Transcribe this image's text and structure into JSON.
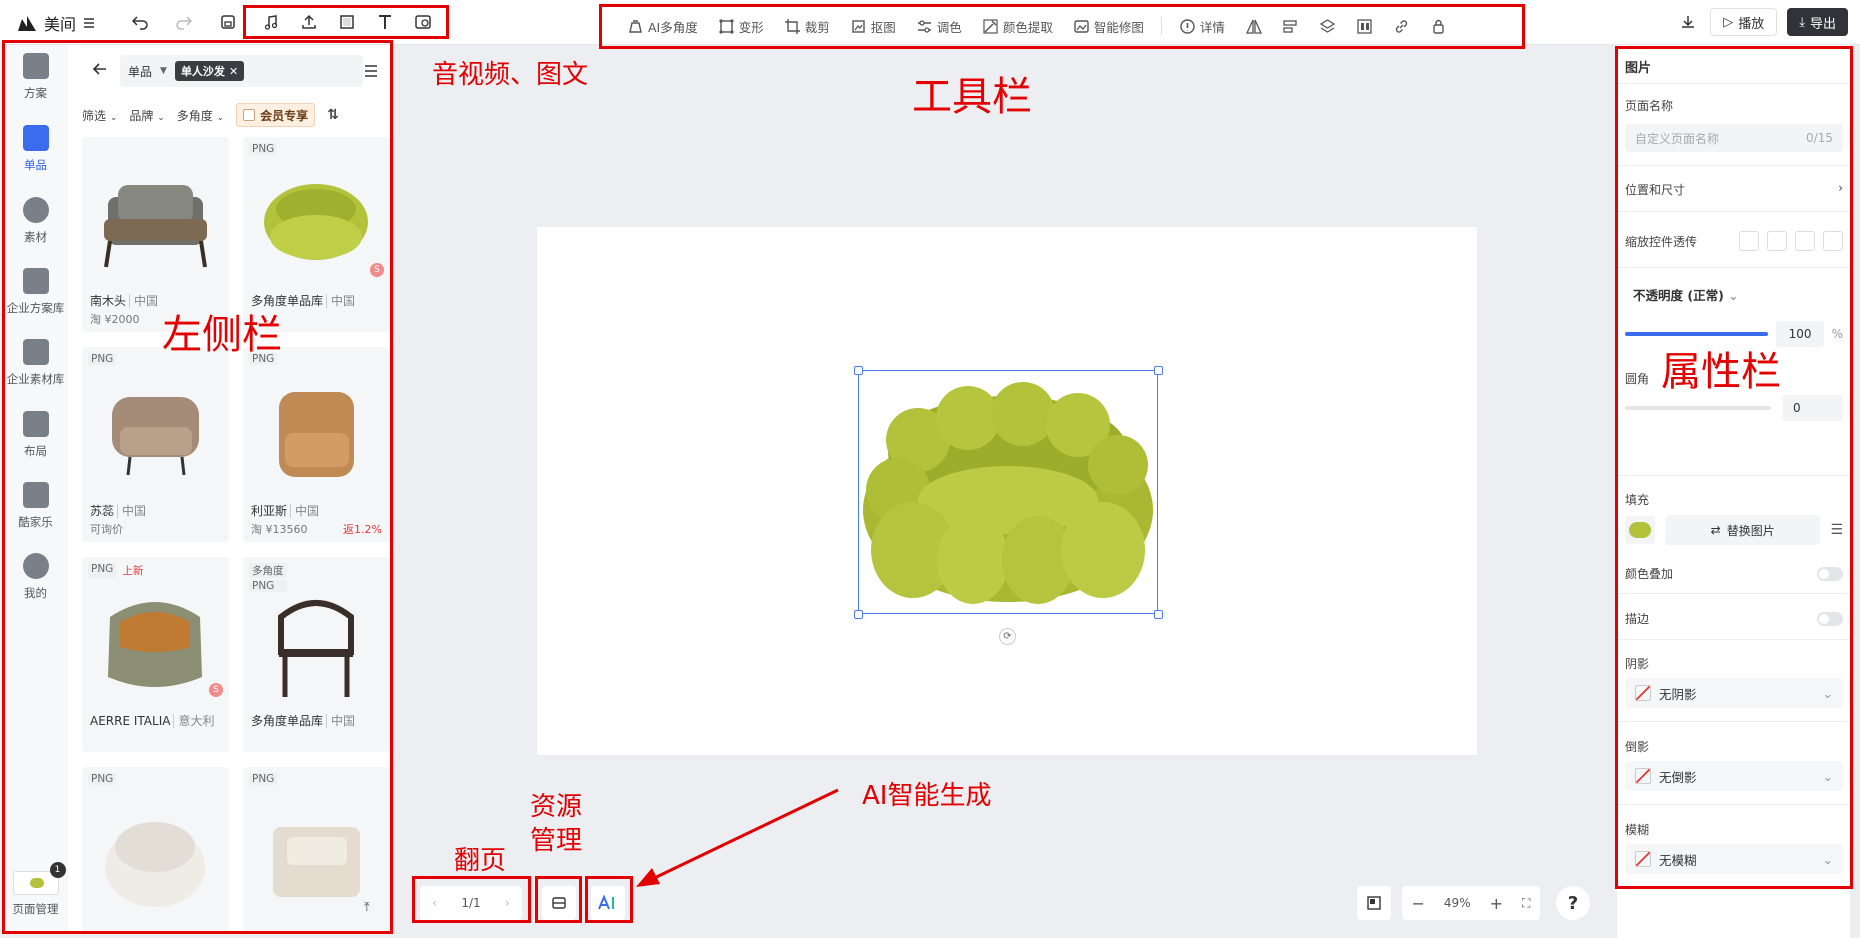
{
  "app": {
    "name": "美间"
  },
  "toolbar": {
    "tools": [
      {
        "label": "AI多角度",
        "icon": "ai-angle-icon"
      },
      {
        "label": "变形",
        "icon": "transform-icon"
      },
      {
        "label": "裁剪",
        "icon": "crop-icon"
      },
      {
        "label": "抠图",
        "icon": "cutout-icon"
      },
      {
        "label": "调色",
        "icon": "adjust-color-icon"
      },
      {
        "label": "颜色提取",
        "icon": "color-picker-icon"
      },
      {
        "label": "智能修图",
        "icon": "smart-retouch-icon"
      },
      {
        "label": "详情",
        "icon": "info-icon"
      }
    ],
    "play_label": "播放",
    "export_label": "导出"
  },
  "rail": {
    "items": [
      {
        "label": "方案"
      },
      {
        "label": "单品"
      },
      {
        "label": "素材"
      },
      {
        "label": "企业方案库"
      },
      {
        "label": "企业素材库"
      },
      {
        "label": "布局"
      },
      {
        "label": "酷家乐"
      },
      {
        "label": "我的"
      }
    ],
    "page_manage_label": "页面管理",
    "page_badge": "1"
  },
  "panel": {
    "category": "单品",
    "search_tag": "单人沙发",
    "filters": [
      "筛选",
      "品牌",
      "多角度"
    ],
    "member_label": "会员专享",
    "products": [
      {
        "tags": [],
        "name": "南木头",
        "origin": "中国",
        "price": "淘 ¥2000",
        "rebate": "",
        "s": false
      },
      {
        "tags": [
          "PNG"
        ],
        "name": "多角度单品库",
        "origin": "中国",
        "price": "",
        "rebate": "",
        "s": true
      },
      {
        "tags": [
          "PNG"
        ],
        "name": "苏蕊",
        "origin": "中国",
        "price": "可询价",
        "rebate": "",
        "s": false
      },
      {
        "tags": [
          "PNG"
        ],
        "name": "利亚斯",
        "origin": "中国",
        "price": "淘 ¥13560",
        "rebate": "返1.2%",
        "s": false
      },
      {
        "tags": [
          "PNG",
          "上新"
        ],
        "name": "AERRE ITALIA",
        "origin": "意大利",
        "price": "",
        "rebate": "",
        "s": true
      },
      {
        "tags": [
          "多角度",
          "PNG"
        ],
        "name": "多角度单品库",
        "origin": "中国",
        "price": "",
        "rebate": "",
        "s": false
      },
      {
        "tags": [
          "PNG"
        ],
        "name": "",
        "origin": "",
        "price": "",
        "rebate": "",
        "s": false
      },
      {
        "tags": [
          "PNG"
        ],
        "name": "",
        "origin": "",
        "price": "",
        "rebate": "",
        "s": false
      }
    ]
  },
  "canvas": {
    "page": "1/1",
    "zoom": "49%",
    "help": "?"
  },
  "props": {
    "title": "图片",
    "page_name_label": "页面名称",
    "page_name_placeholder": "自定义页面名称",
    "page_name_count": "0/15",
    "position_label": "位置和尺寸",
    "transparency_label": "缩放控件透传",
    "opacity_label": "不透明度 (正常)",
    "opacity_value": "100",
    "opacity_unit": "%",
    "opacity_level": 1.0,
    "radius_label": "圆角",
    "radius_value": "0",
    "fill_label": "填充",
    "replace_label": "替换图片",
    "overlay_label": "颜色叠加",
    "stroke_label": "描边",
    "shadow_label": "阴影",
    "shadow_value": "无阴影",
    "reflection_label": "倒影",
    "reflection_value": "无倒影",
    "blur_label": "模糊",
    "blur_value": "无模糊"
  },
  "annotations": {
    "media": "音视频、图文",
    "toolbar": "工具栏",
    "sidebar": "左侧栏",
    "props": "属性栏",
    "pager": "翻页",
    "resource": "资源\n管理",
    "ai": "AI智能生成"
  },
  "colors": {
    "annotation": "#e30000",
    "accent": "#3b6cf0",
    "sofa": "#b2c23a"
  }
}
